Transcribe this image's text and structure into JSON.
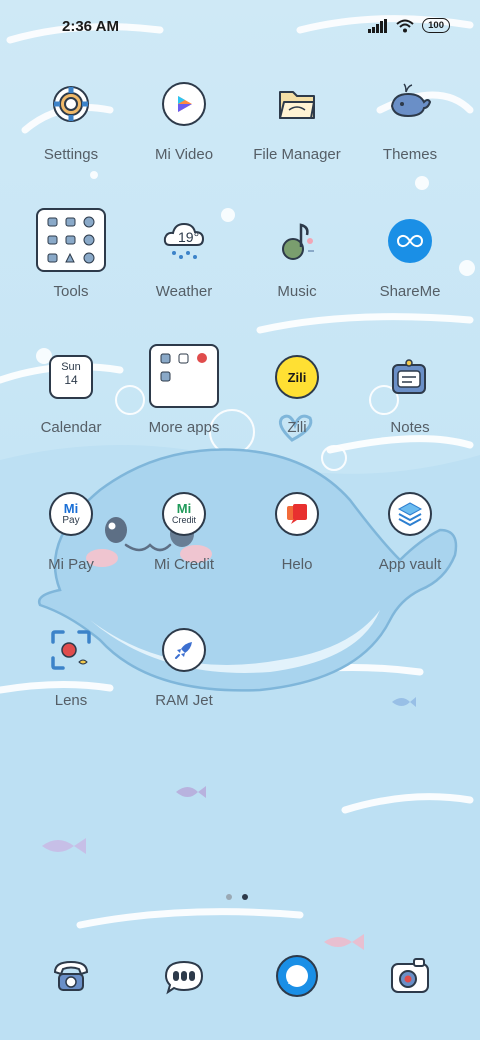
{
  "status_bar": {
    "time": "2:36 AM",
    "battery": "100"
  },
  "apps": {
    "settings": "Settings",
    "mi_video": "Mi Video",
    "file_manager": "File Manager",
    "themes": "Themes",
    "tools": "Tools",
    "weather": "Weather",
    "weather_temp": "19°",
    "music": "Music",
    "shareme": "ShareMe",
    "calendar": "Calendar",
    "calendar_day": "Sun",
    "calendar_date": "14",
    "more_apps": "More apps",
    "zili": "Zili",
    "zili_logo": "Zili",
    "notes": "Notes",
    "mi_pay": "Mi Pay",
    "mi_pay_logo": "Pay",
    "mi_credit": "Mi Credit",
    "mi_credit_logo": "Credit",
    "helo": "Helo",
    "app_vault": "App vault",
    "lens": "Lens",
    "ram_jet": "RAM Jet"
  },
  "pager": {
    "pages": 2,
    "current": 2
  },
  "dock": {
    "items": [
      "phone-icon",
      "messages-icon",
      "browser-icon",
      "camera-icon"
    ]
  },
  "colors": {
    "outline": "#2d3a4a",
    "label": "#555e66",
    "whale": "#a9d4ee",
    "accent_blue": "#1a8fe6"
  }
}
